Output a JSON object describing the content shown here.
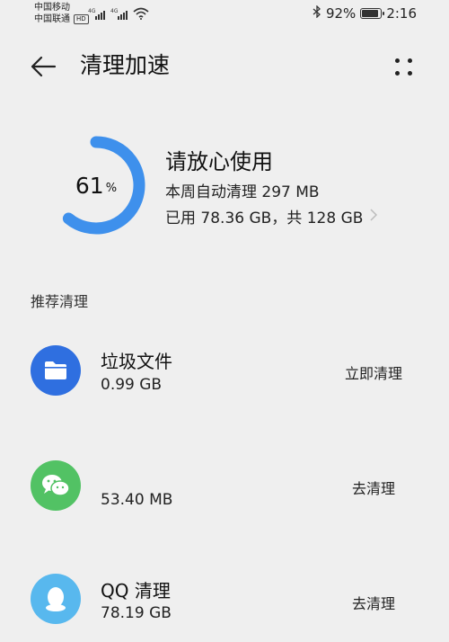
{
  "status_bar": {
    "carrier1": "中国移动",
    "carrier2": "中国联通",
    "hd": "HD",
    "net1": "4G",
    "net2": "4G",
    "battery_text": "92%",
    "battery_level": 0.92,
    "time": "2:16"
  },
  "header": {
    "title": "清理加速"
  },
  "storage": {
    "percent_number": "61",
    "percent_sign": "%",
    "percent_value": 0.61,
    "ring_color": "#3e90ec",
    "status_title": "请放心使用",
    "week_cleaned": "本周自动清理 297 MB",
    "used_total": "已用 78.36 GB，共 128 GB"
  },
  "section": {
    "title": "推荐清理"
  },
  "items": [
    {
      "name": "垃圾文件",
      "size": "0.99 GB",
      "action": "立即清理",
      "icon": "folder-icon",
      "color": "#2f6fe0"
    },
    {
      "name": "",
      "size": "53.40 MB",
      "action": "去清理",
      "icon": "wechat-icon",
      "color": "#52c264"
    },
    {
      "name": "QQ 清理",
      "size": "78.19 GB",
      "action": "去清理",
      "icon": "qq-icon",
      "color": "#58b8ee"
    }
  ]
}
